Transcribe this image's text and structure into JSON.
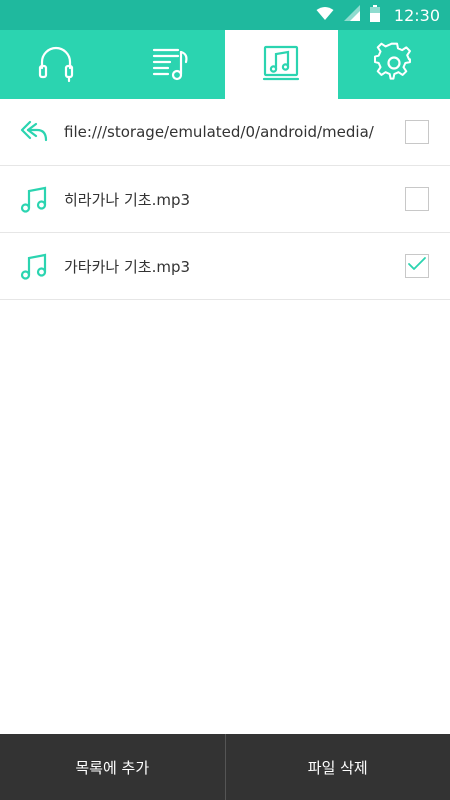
{
  "status_bar": {
    "time": "12:30",
    "icons": [
      "wifi-icon",
      "signal-icon",
      "battery-icon"
    ]
  },
  "tabs": [
    {
      "icon": "headphones-icon",
      "active": false
    },
    {
      "icon": "playlist-icon",
      "active": false
    },
    {
      "icon": "music-folder-icon",
      "active": true
    },
    {
      "icon": "settings-gear-icon",
      "active": false
    }
  ],
  "file_list": {
    "path_row": {
      "icon": "back-arrow-icon",
      "label": "file:///storage/emulated/0/android/media/",
      "checked": false
    },
    "files": [
      {
        "icon": "music-note-icon",
        "label": "히라가나 기초.mp3",
        "checked": false
      },
      {
        "icon": "music-note-icon",
        "label": "가타카나 기초.mp3",
        "checked": true
      }
    ]
  },
  "bottom_bar": {
    "add_label": "목록에 추가",
    "delete_label": "파일 삭제"
  },
  "colors": {
    "accent": "#2bd4b0",
    "status_bar": "#1fb99e",
    "bottom_bar": "#333333"
  }
}
